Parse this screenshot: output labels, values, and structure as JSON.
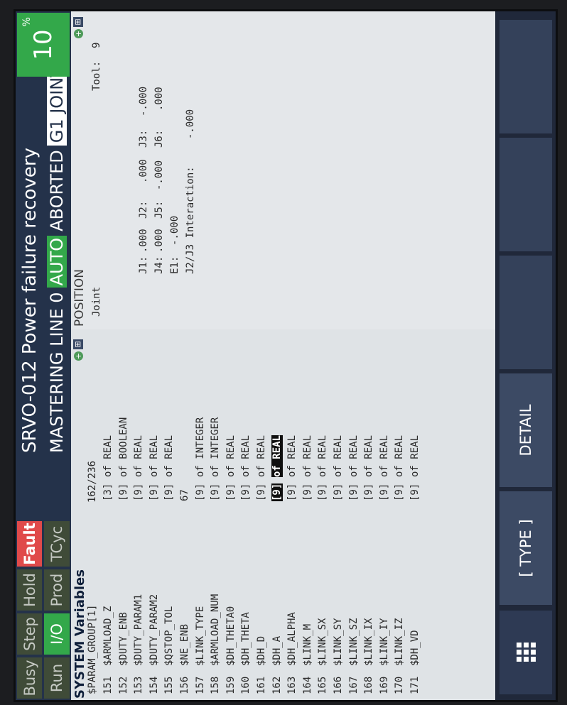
{
  "status_bar": {
    "buttons": [
      {
        "label": "Busy",
        "state": "off"
      },
      {
        "label": "Step",
        "state": "off"
      },
      {
        "label": "Hold",
        "state": "off"
      },
      {
        "label": "Fault",
        "state": "fault"
      },
      {
        "label": "Run",
        "state": "off"
      },
      {
        "label": "I/O",
        "state": "on"
      },
      {
        "label": "Prod",
        "state": "off"
      },
      {
        "label": "TCyc",
        "state": "off"
      }
    ],
    "alarm": "SRVO-012 Power failure recovery",
    "program_line": "MASTERING LINE 0",
    "mode": "AUTO",
    "execution_state": "ABORTED",
    "group_joint": "G1 JOINT",
    "override_value": "10",
    "override_unit": "%"
  },
  "vars_pane": {
    "title": "SYSTEM Variables",
    "group_name": "$PARAM_GROUP[1]",
    "position_counter": "162/236",
    "rows": [
      {
        "num": "151",
        "name": "$ARMLOAD_Z",
        "dim": "[3]",
        "type": "of REAL"
      },
      {
        "num": "152",
        "name": "$DUTY_ENB",
        "dim": "[9]",
        "type": "of BOOLEAN"
      },
      {
        "num": "153",
        "name": "$DUTY_PARAM1",
        "dim": "[9]",
        "type": "of REAL"
      },
      {
        "num": "154",
        "name": "$DUTY_PARAM2",
        "dim": "[9]",
        "type": "of REAL"
      },
      {
        "num": "155",
        "name": "$QSTOP_TOL",
        "dim": "[9]",
        "type": "of REAL"
      },
      {
        "num": "156",
        "name": "$NE_ENB",
        "dim": "67",
        "type": ""
      },
      {
        "num": "157",
        "name": "$LINK_TYPE",
        "dim": "[9]",
        "type": "of INTEGER"
      },
      {
        "num": "158",
        "name": "$ARMLOAD_NUM",
        "dim": "[9]",
        "type": "of INTEGER"
      },
      {
        "num": "159",
        "name": "$DH_THETA0",
        "dim": "[9]",
        "type": "of REAL"
      },
      {
        "num": "160",
        "name": "$DH_THETA",
        "dim": "[9]",
        "type": "of REAL"
      },
      {
        "num": "161",
        "name": "$DH_D",
        "dim": "[9]",
        "type": "of REAL"
      },
      {
        "num": "162",
        "name": "$DH_A",
        "dim": "[9]",
        "type": "of REAL",
        "selected": true
      },
      {
        "num": "163",
        "name": "$DH_ALPHA",
        "dim": "[9]",
        "type": "of REAL"
      },
      {
        "num": "164",
        "name": "$LINK_M",
        "dim": "[9]",
        "type": "of REAL"
      },
      {
        "num": "165",
        "name": "$LINK_SX",
        "dim": "[9]",
        "type": "of REAL"
      },
      {
        "num": "166",
        "name": "$LINK_SY",
        "dim": "[9]",
        "type": "of REAL"
      },
      {
        "num": "167",
        "name": "$LINK_SZ",
        "dim": "[9]",
        "type": "of REAL"
      },
      {
        "num": "168",
        "name": "$LINK_IX",
        "dim": "[9]",
        "type": "of REAL"
      },
      {
        "num": "169",
        "name": "$LINK_IY",
        "dim": "[9]",
        "type": "of REAL"
      },
      {
        "num": "170",
        "name": "$LINK_IZ",
        "dim": "[9]",
        "type": "of REAL"
      },
      {
        "num": "171",
        "name": "$DH_VD",
        "dim": "[9]",
        "type": "of REAL"
      }
    ]
  },
  "position_pane": {
    "title": "POSITION",
    "frame": "Joint",
    "tool_label": "Tool:",
    "tool_value": "9",
    "j1_label": "J1:",
    "j1": ".000",
    "j2_label": "J2:",
    "j2": ".000",
    "j3_label": "J3:",
    "j3": "-.000",
    "j4_label": "J4:",
    "j4": ".000",
    "j5_label": "J5:",
    "j5": "-.000",
    "j6_label": "J6:",
    "j6": ".000",
    "e1_label": "E1:",
    "e1": "-.000",
    "interaction_label": "J2/J3 Interaction:",
    "interaction_value": "-.000"
  },
  "function_keys": {
    "menu_icon": "grid-menu-icon",
    "f1": "[ TYPE ]",
    "f2": "DETAIL",
    "f3": "",
    "f4": "",
    "f5": ""
  },
  "colors": {
    "status_bar": "#24324a",
    "active_green": "#33a84a",
    "fault_red": "#e04a4a",
    "inactive_olive": "#3f4b38",
    "selection": "#0f0f0f"
  }
}
